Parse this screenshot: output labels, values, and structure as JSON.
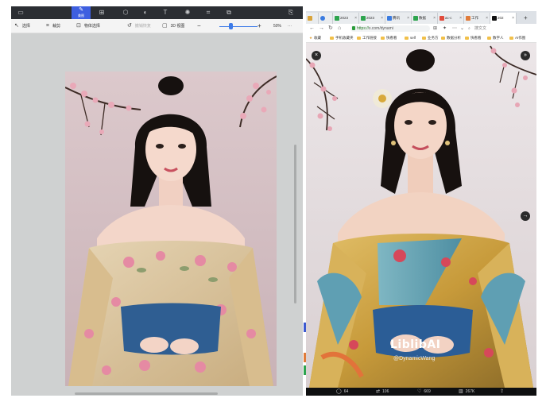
{
  "editor": {
    "toolbar": {
      "active_tool_label": "美图",
      "tools": [
        "window-icon",
        "brush-icon",
        "transform-icon",
        "cube-icon",
        "palette-icon",
        "text-icon",
        "sun-icon",
        "crop-icon",
        "layers-icon",
        "export-icon"
      ]
    },
    "optionbar": {
      "select_label": "选择",
      "crop_label": "裁剪",
      "object_select_label": "物体选择",
      "restore_label": "撤销恢复",
      "3d_view_label": "3D 视图",
      "zoom_minus": "−",
      "zoom_plus": "+",
      "zoom_value": "50%",
      "more": "···",
      "zoom_level": 0.3
    }
  },
  "browser": {
    "tabs": [
      {
        "label": "",
        "color": "#d9a43a"
      },
      {
        "label": "",
        "color": "#3a7be0"
      },
      {
        "label": "2023",
        "color": "#2da44e"
      },
      {
        "label": "2023",
        "color": "#2da44e"
      },
      {
        "label": "腾讯",
        "color": "#3a7be0"
      },
      {
        "label": "数据",
        "color": "#2da44e"
      },
      {
        "label": "ac-c",
        "color": "#e04a3a"
      },
      {
        "label": "工作",
        "color": "#e07b3a"
      },
      {
        "label": "202",
        "color": "#111111",
        "active": true
      }
    ],
    "url_scheme": "https://",
    "url_rest": "x.com/dynami",
    "search_placeholder": "搜文文",
    "bookmarks": [
      "收藏",
      "手机收藏夹",
      "工作链接",
      "快看看",
      "self",
      "业务方",
      "数据分析",
      "快看看",
      "数字人",
      "AI作图"
    ],
    "post": {
      "watermark": "LiblibAI",
      "handle": "@DynamicWang",
      "stats": {
        "comments": "64",
        "reposts": "106",
        "likes": "669",
        "views": "267K"
      }
    }
  }
}
